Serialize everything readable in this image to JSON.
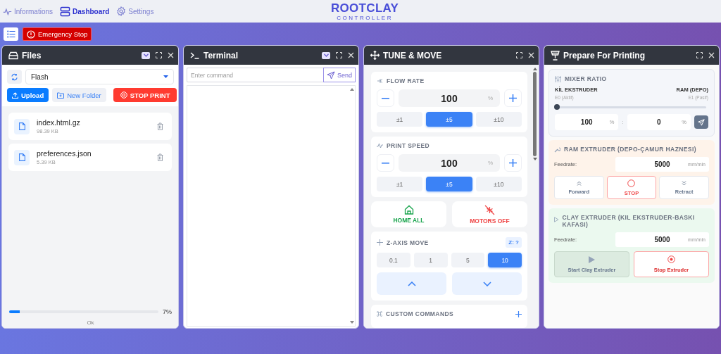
{
  "nav": {
    "items": [
      {
        "label": "Informations",
        "selected": false
      },
      {
        "label": "Dashboard",
        "selected": true
      },
      {
        "label": "Settings",
        "selected": false
      }
    ],
    "logo": {
      "title": "ROOTCLAY",
      "subtitle": "CONTROLLER"
    }
  },
  "toolbar": {
    "emergency": "Emergency Stop"
  },
  "files": {
    "title": "Files",
    "collapsed": false,
    "storage": "Flash",
    "upload": "Upload",
    "new_folder": "New Folder",
    "stop_print": "STOP PRINT",
    "items": [
      {
        "name": "index.html.gz",
        "size": "98.39 KB"
      },
      {
        "name": "preferences.json",
        "size": "5.39 KB"
      }
    ],
    "progress": {
      "level": 0.07,
      "reading": "7%"
    },
    "status": "Ok"
  },
  "terminal": {
    "title": "Terminal",
    "placeholder": "Enter command",
    "send": "Send"
  },
  "tune": {
    "title": "TUNE & MOVE",
    "controls": [
      {
        "label": "FLOW RATE",
        "value": "100",
        "unit": "%",
        "steps": [
          {
            "label": "±1",
            "selected": false
          },
          {
            "label": "±5",
            "selected": true
          },
          {
            "label": "±10",
            "selected": false
          }
        ]
      },
      {
        "label": "PRINT SPEED",
        "value": "100",
        "unit": "%",
        "steps": [
          {
            "label": "±1",
            "selected": false
          },
          {
            "label": "±5",
            "selected": true
          },
          {
            "label": "±10",
            "selected": false
          }
        ]
      }
    ],
    "home": "HOME ALL",
    "motors_off": "MOTORS OFF",
    "z_axis": {
      "label": "Z-AXIS MOVE",
      "position": "Z: ?",
      "steps": [
        {
          "label": "0.1",
          "selected": false
        },
        {
          "label": "1",
          "selected": false
        },
        {
          "label": "5",
          "selected": false
        },
        {
          "label": "10",
          "selected": true
        }
      ]
    },
    "custom_commands": "CUSTOM COMMANDS"
  },
  "prepare": {
    "title": "Prepare For Printing",
    "mixer": {
      "label": "MIXER RATIO",
      "left": {
        "name": "KİL EKSTRUDER",
        "sub": "E0 (Aktif)"
      },
      "right": {
        "name": "RAM (DEPO)",
        "sub": "E1 (Pasif)"
      },
      "level": 0,
      "left_value": "100",
      "right_value": "0",
      "unit": "%",
      "separator": ":"
    },
    "ram": {
      "label": "RAM EXTRUDER (DEPO-ÇAMUR HAZNESI)",
      "feedrate_label": "Feedrate:",
      "feedrate": "5000",
      "unit": "mm/min",
      "forward": "Forward",
      "stop": "STOP",
      "retract": "Retract"
    },
    "clay": {
      "label": "CLAY EXTRUDER (KIL EKSTRUDER-BASKI KAFASI)",
      "feedrate_label": "Feedrate:",
      "feedrate": "5000",
      "unit": "mm/min",
      "start": "Start Clay Extruder",
      "start_disabled": true,
      "stop": "Stop Extruder"
    }
  }
}
